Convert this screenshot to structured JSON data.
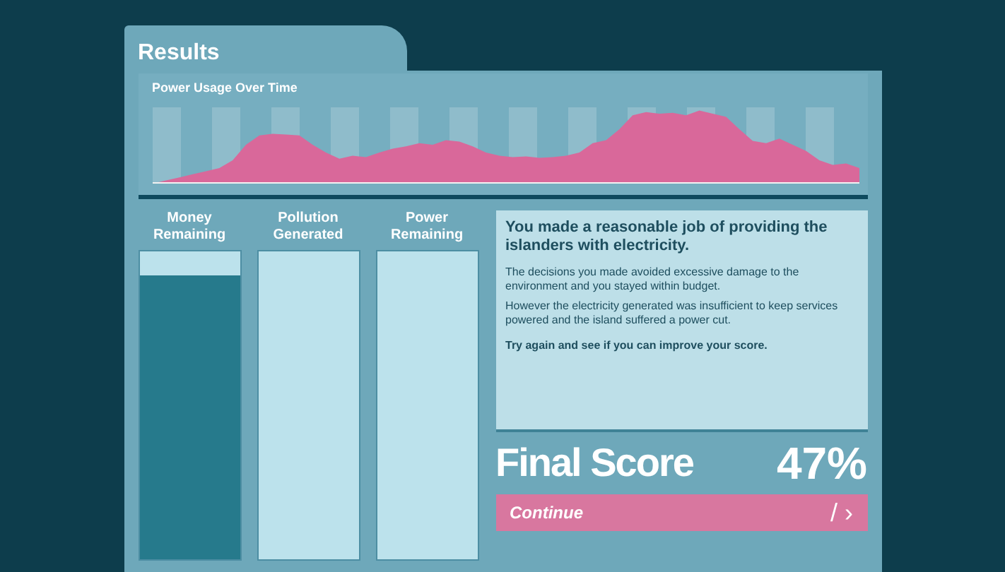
{
  "title": "Results",
  "chart": {
    "title": "Power Usage Over Time"
  },
  "meters": [
    {
      "label": "Money Remaining",
      "level": 0.92
    },
    {
      "label": "Pollution Generated",
      "level": 0
    },
    {
      "label": "Power Remaining",
      "level": 0
    }
  ],
  "message": {
    "headline": "You made a reasonable job of providing the islanders with electricity.",
    "paragraphs": [
      "The decisions you made avoided excessive damage to the environment and you stayed within budget.",
      "However the electricity generated was insufficient to keep services powered and the island suffered a power cut."
    ],
    "call_to_action": "Try again and see if you can improve your score."
  },
  "final_score": {
    "label": "Final Score",
    "value": "47%"
  },
  "continue_button": {
    "label": "Continue",
    "icon_text": "/ ›"
  }
}
